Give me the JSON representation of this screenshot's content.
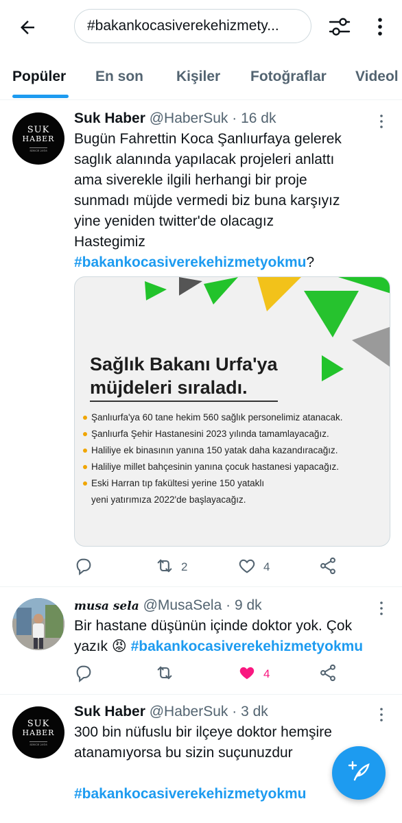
{
  "header": {
    "search_value": "#bakankocasiverekehizmetyokmu",
    "search_display": "#bakankocasiverekehizmety..."
  },
  "tabs": [
    {
      "label": "Popüler"
    },
    {
      "label": "En son"
    },
    {
      "label": "Kişiler"
    },
    {
      "label": "Fotoğraflar"
    },
    {
      "label": "Videol"
    }
  ],
  "tweets": [
    {
      "avatar_text": [
        "SUK",
        "HABER",
        "SINCE 2018"
      ],
      "name": "Suk Haber",
      "handle": "@HaberSuk",
      "sep": "·",
      "time": "16 dk",
      "text": "Bugün Fahrettin Koca Şanlıurfaya gelerek\nsaglık alanında yapılacak projeleri anlattı\nama siverekle ilgili herhangi bir proje\nsunmadı müjde vermedi biz buna karşıyız\nyine yeniden twitter'de olacagız\nHastegimiz",
      "hashtag": "#bakankocasiverekehizmetyokmu",
      "suffix": "?",
      "media": {
        "title_line1": "Sağlık Bakanı Urfa'ya",
        "title_line2": "müjdeleri sıraladı.",
        "items": [
          "Şanlıurfa'ya 60 tane hekim 560 sağlık personelimiz atanacak.",
          "Şanlıurfa Şehir Hastanesini 2023 yılında tamamlayacağız.",
          "Haliliye ek binasının yanına 150 yatak daha kazandıracağız.",
          "Haliliye millet bahçesinin yanına çocuk hastanesi yapacağız.",
          "Eski Harran tıp fakültesi yerine 150 yataklı",
          "yeni yatırımıza 2022'de başlayacağız."
        ]
      },
      "reply_count": "",
      "retweet_count": "2",
      "like_count": "4"
    },
    {
      "name": "musa sela",
      "handle": "@MusaSela",
      "sep": "·",
      "time": "9 dk",
      "text_line1": "Bir hastane düşünün içinde doktor yok. Çok",
      "text_line2": "yazık",
      "emoji": "😡",
      "hashtag": "#bakankocasiverekehizmetyokmu",
      "retweet_count": "",
      "like_count": "4"
    },
    {
      "avatar_text": [
        "SUK",
        "HABER",
        "SINCE 2018"
      ],
      "name": "Suk Haber",
      "handle": "@HaberSuk",
      "sep": "·",
      "time": "3 dk",
      "text": "300 bin nüfuslu bir ilçeye doktor hemşire\natanamıyorsa bu sizin suçunuzdur",
      "hashtag": "#bakankocasiverekehizmetyokmu"
    }
  ],
  "colors": {
    "accent": "#1d9bf0",
    "like": "#f91880",
    "secondary_text": "#536471"
  },
  "icons": [
    "back-arrow-icon",
    "filter-icon",
    "more-vertical-icon",
    "reply-icon",
    "retweet-icon",
    "like-icon",
    "share-icon",
    "compose-icon"
  ]
}
